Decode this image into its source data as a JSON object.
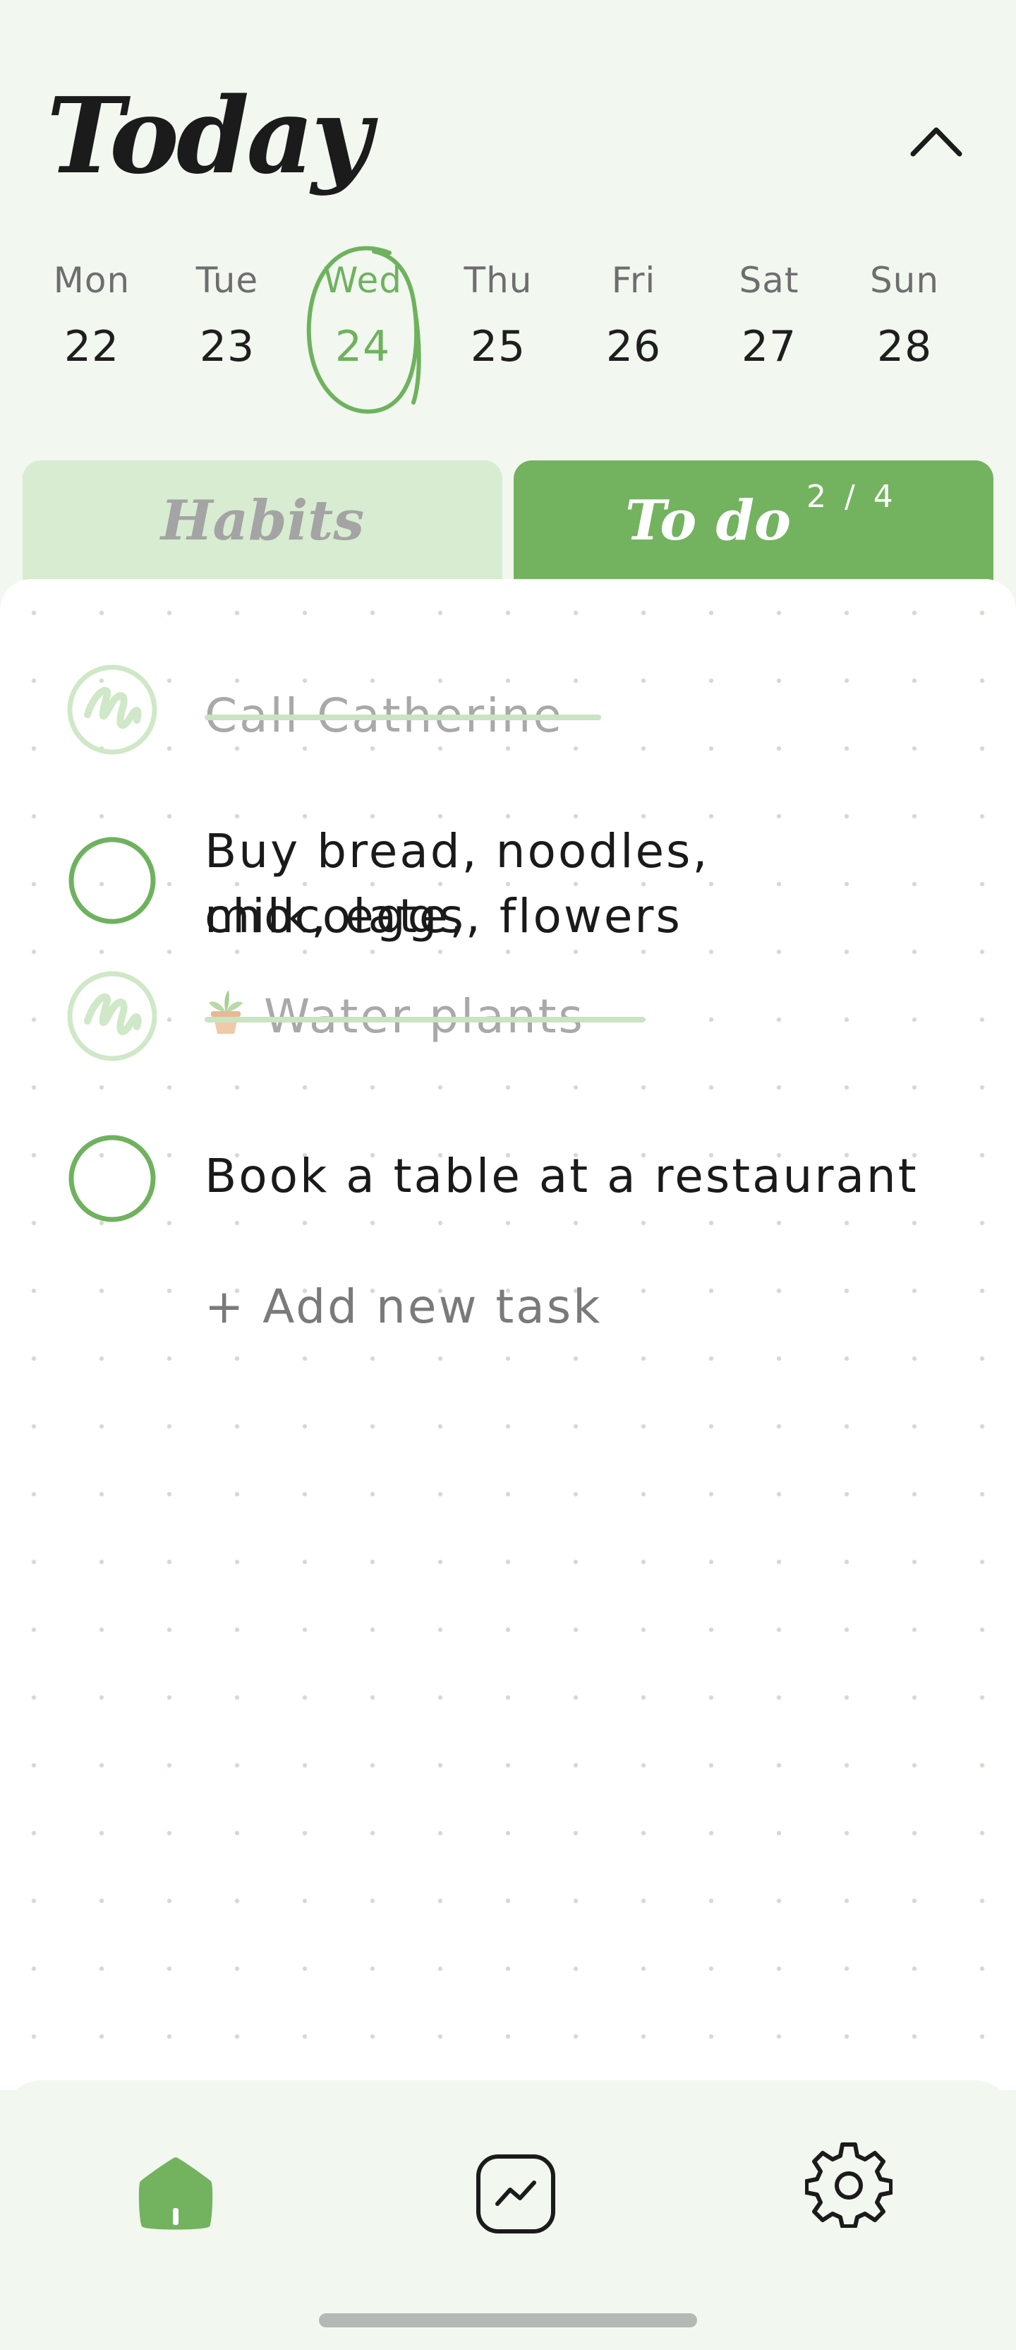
{
  "header": {
    "title": "Today"
  },
  "week": {
    "days": [
      {
        "name": "Mon",
        "num": "22"
      },
      {
        "name": "Tue",
        "num": "23"
      },
      {
        "name": "Wed",
        "num": "24"
      },
      {
        "name": "Thu",
        "num": "25"
      },
      {
        "name": "Fri",
        "num": "26"
      },
      {
        "name": "Sat",
        "num": "27"
      },
      {
        "name": "Sun",
        "num": "28"
      }
    ],
    "selected": "Wed"
  },
  "tabs": {
    "habits_label": "Habits",
    "todo_label": "To do",
    "todo_count": "2 / 4"
  },
  "tasks": [
    {
      "text": "Call Catherine",
      "done": true
    },
    {
      "line1": "Buy bread, noodles, chocolate,",
      "line2": "milk, eggs, flowers",
      "done": false
    },
    {
      "text": "Water plants",
      "done": true,
      "icon": "potted-plant-icon"
    },
    {
      "text": "Book a table at a restaurant",
      "done": false
    }
  ],
  "add_task_label": "+ Add new task",
  "nav": {
    "items": [
      "home-icon",
      "stats-icon",
      "gear-icon"
    ],
    "active": "home-icon"
  },
  "colors": {
    "accent": "#73b35f",
    "accent_light": "#d7ecd1",
    "background": "#f2f7f0"
  }
}
